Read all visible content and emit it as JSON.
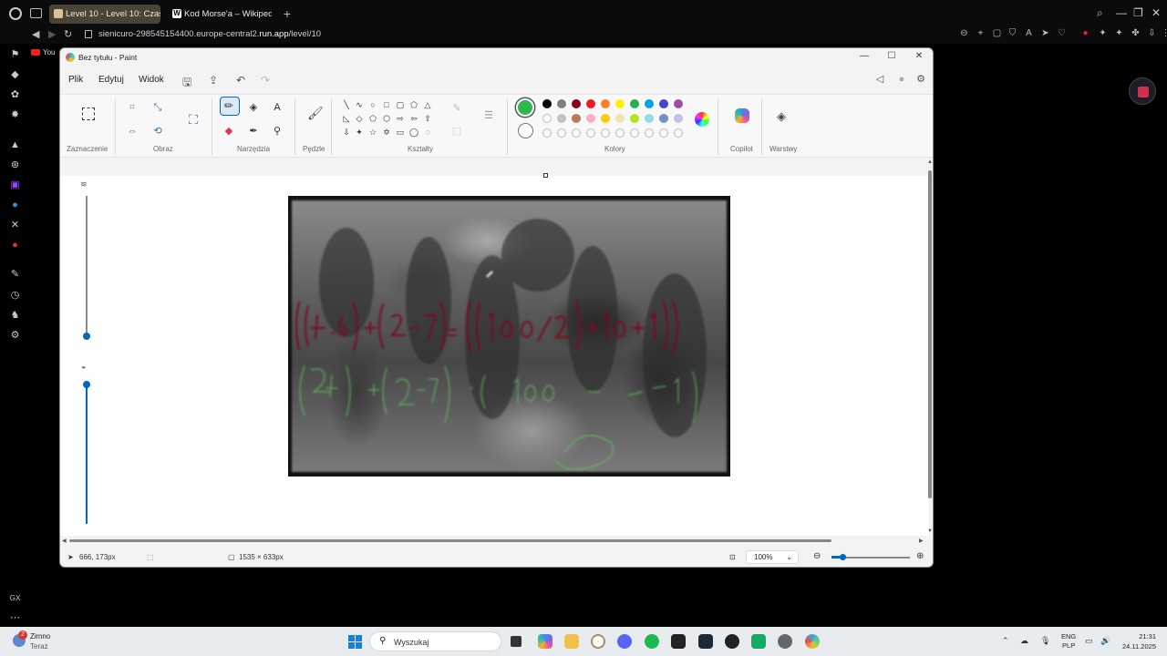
{
  "browser": {
    "tabs": [
      {
        "title": "Level 10 - Level 10: Czas"
      },
      {
        "title": "Kod Morse'a – Wikipedia,",
        "favicon_letter": "W"
      }
    ],
    "new_tab": "+",
    "url_prefix": "sienicuro-298545154400.europe-central2.",
    "url_domain": "run.app",
    "url_path": "/level/10",
    "bookmark_youtube": "You",
    "sidebar_bottom_label": "GX"
  },
  "paint": {
    "window_title": "Bez tytułu - Paint",
    "menu": {
      "file": "Plik",
      "edit": "Edytuj",
      "view": "Widok"
    },
    "groups": {
      "selection": "Zaznaczenie",
      "image": "Obraz",
      "tools": "Narzędzia",
      "brushes": "Pędzle",
      "shapes": "Kształty",
      "colors": "Kolory",
      "copilot": "Copilot",
      "layers": "Warstwy"
    },
    "colors": {
      "primary": "#2cb84a",
      "palette_row1": [
        "#000000",
        "#7f7f7f",
        "#880015",
        "#ed1c24",
        "#ff7f27",
        "#fff200",
        "#22b14c",
        "#00a2e8",
        "#3f48cc",
        "#a349a4"
      ],
      "palette_row2": [
        "#ffffff",
        "#c3c3c3",
        "#b97a57",
        "#ffaec9",
        "#ffc90e",
        "#efe4b0",
        "#b5e61d",
        "#99d9ea",
        "#7092be",
        "#c8bfe7"
      ]
    },
    "status": {
      "cursor_pos": "666, 173px",
      "image_size": "1535 × 633px",
      "zoom": "100%"
    },
    "zoom_fraction": 0.1
  },
  "taskbar": {
    "weather_title": "Zimno",
    "weather_sub": "Teraz",
    "weather_badge": "2",
    "search_placeholder": "Wyszukaj",
    "lang_top": "ENG",
    "lang_bottom": "PLP",
    "time": "21:31",
    "date": "24.11.2025"
  }
}
